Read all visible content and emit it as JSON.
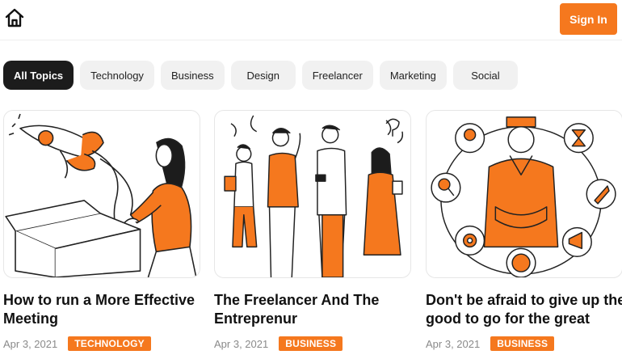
{
  "header": {
    "home_icon": "home-icon",
    "signin_label": "Sign In",
    "accent": "#f5781e"
  },
  "topics": [
    {
      "label": "All Topics",
      "active": true
    },
    {
      "label": "Technology",
      "active": false
    },
    {
      "label": "Business",
      "active": false
    },
    {
      "label": "Design",
      "active": false
    },
    {
      "label": "Freelancer",
      "active": false
    },
    {
      "label": "Marketing",
      "active": false
    },
    {
      "label": "Social",
      "active": false
    }
  ],
  "posts": [
    {
      "title": "How to run a More Effective Meeting",
      "date": "Apr 3, 2021",
      "tag": "TECHNOLOGY"
    },
    {
      "title": "The Freelancer And The Entreprenur",
      "date": "Apr 3, 2021",
      "tag": "BUSINESS"
    },
    {
      "title": "Don't be afraid to give up the good to go for the great",
      "date": "Apr 3, 2021",
      "tag": "BUSINESS"
    }
  ]
}
